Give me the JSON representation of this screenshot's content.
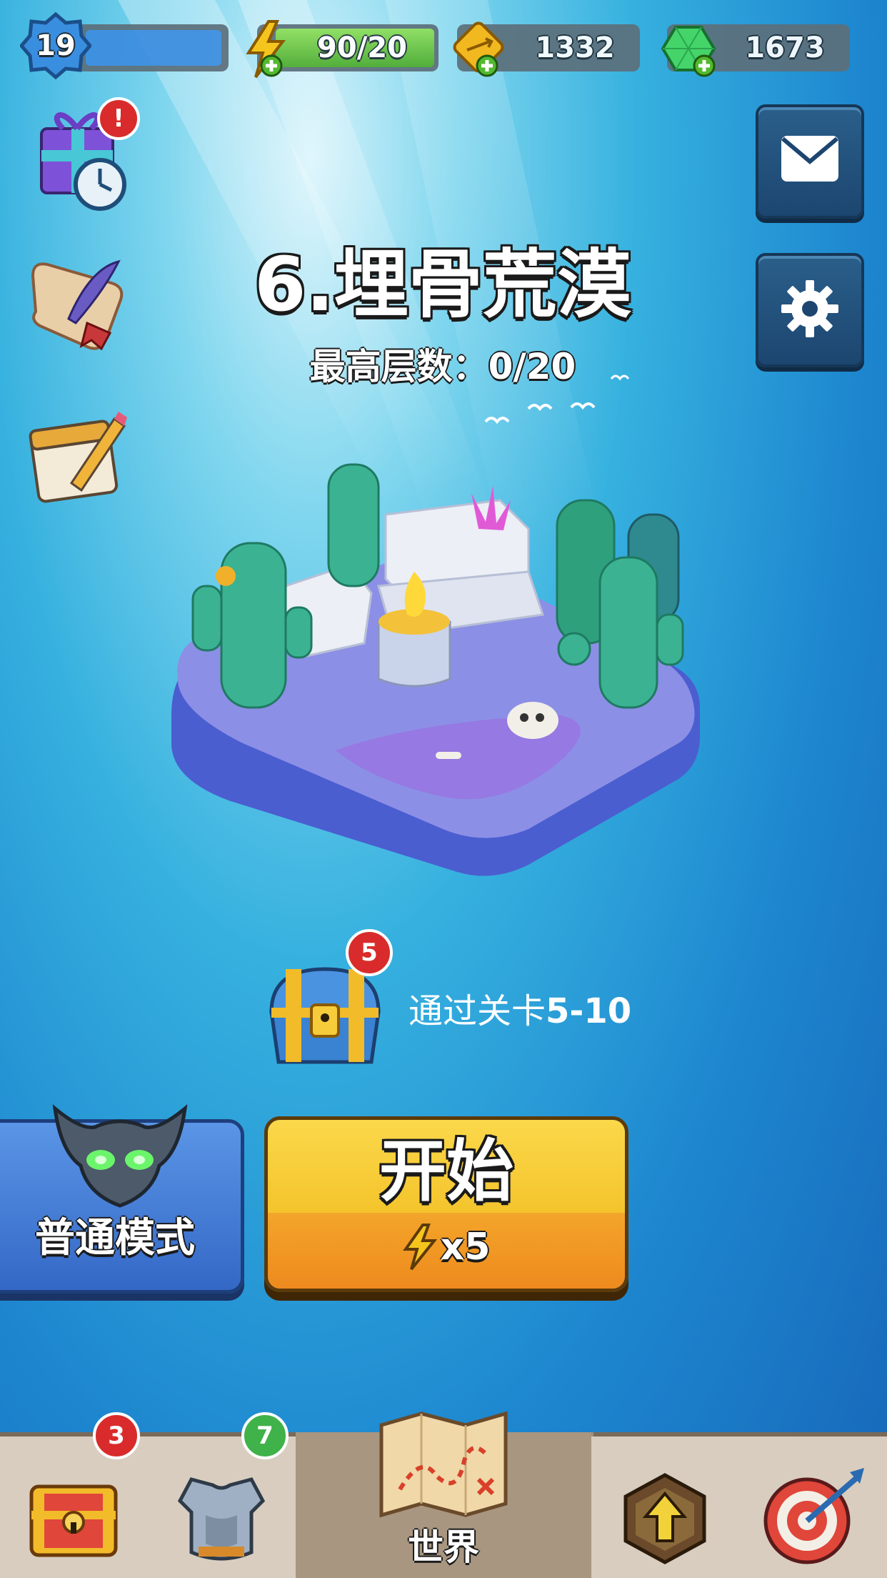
{
  "top_bar": {
    "level": "19",
    "energy": "90/20",
    "arrow_currency": "1332",
    "gems": "1673"
  },
  "stage": {
    "title": "6.埋骨荒漠",
    "max_floor": "最高层数：0/20"
  },
  "reward": {
    "chest_badge": "5",
    "text": "通过关卡",
    "level_range": "5-10"
  },
  "mode_button": {
    "label": "普通模式"
  },
  "start_button": {
    "label": "开始",
    "cost": "x5"
  },
  "bottom_nav": {
    "chest_badge": "3",
    "armor_badge": "7",
    "world_label": "世界"
  },
  "colors": {
    "energy_bar": "#5fc43a",
    "xp_bar": "#3c8ddf",
    "start_top": "#f8cc38",
    "start_bottom": "#f09a26",
    "mode_button": "#3f7fd6"
  }
}
